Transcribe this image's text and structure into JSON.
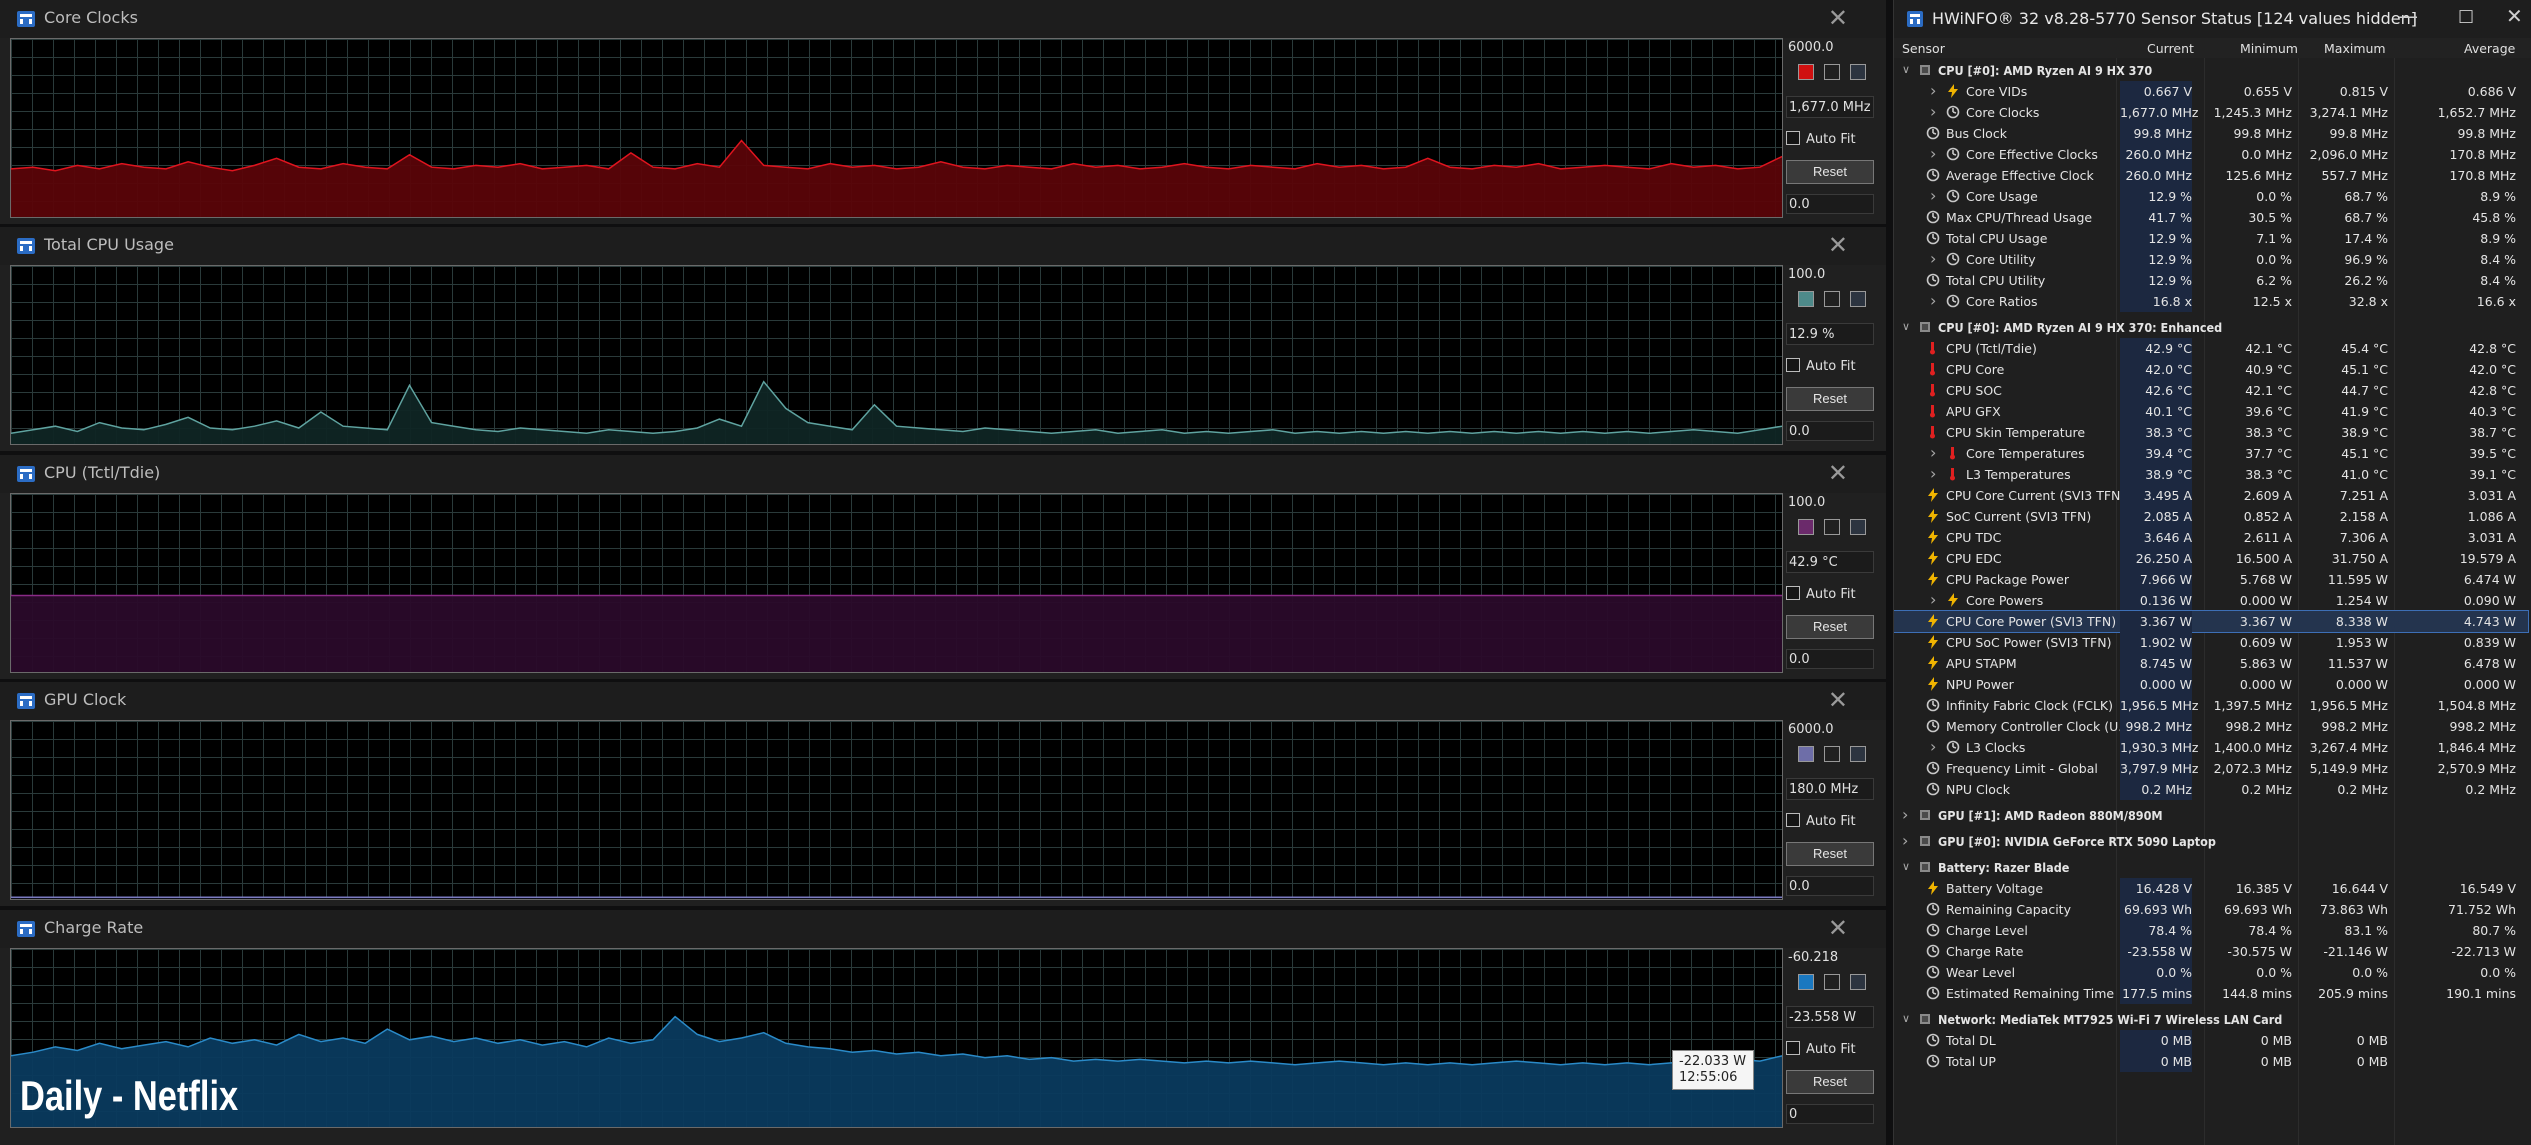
{
  "graphs": [
    {
      "title": "Core Clocks",
      "max": "6000.0",
      "current": "1,677.0 MHz",
      "min": "0.0",
      "auto_fit": "Auto Fit",
      "reset": "Reset",
      "color": "#e0141e",
      "fill": "#5a0408",
      "swatch": "#d01010",
      "level": 0.28,
      "spikes": [
        0.32,
        0.36,
        0.42
      ],
      "series": [
        0.27,
        0.28,
        0.26,
        0.29,
        0.27,
        0.3,
        0.28,
        0.27,
        0.31,
        0.28,
        0.26,
        0.29,
        0.33,
        0.28,
        0.27,
        0.3,
        0.28,
        0.27,
        0.35,
        0.28,
        0.27,
        0.29,
        0.28,
        0.3,
        0.27,
        0.28,
        0.29,
        0.27,
        0.36,
        0.28,
        0.27,
        0.3,
        0.28,
        0.43,
        0.29,
        0.28,
        0.27,
        0.3,
        0.28,
        0.29,
        0.27,
        0.28,
        0.31,
        0.28,
        0.27,
        0.29,
        0.28,
        0.27,
        0.3,
        0.28,
        0.29,
        0.27,
        0.28,
        0.3,
        0.28,
        0.27,
        0.29,
        0.28,
        0.27,
        0.3,
        0.28,
        0.29,
        0.27,
        0.28,
        0.33,
        0.28,
        0.27,
        0.29,
        0.28,
        0.3,
        0.27,
        0.28,
        0.29,
        0.28,
        0.27,
        0.3,
        0.28,
        0.29,
        0.27,
        0.28,
        0.34
      ]
    },
    {
      "title": "Total CPU Usage",
      "max": "100.0",
      "current": "12.9 %",
      "min": "0.0",
      "auto_fit": "Auto Fit",
      "reset": "Reset",
      "color": "#5fa3a0",
      "fill": "#0f2524",
      "swatch": "#4e8a8a",
      "series": [
        0.06,
        0.08,
        0.1,
        0.07,
        0.12,
        0.09,
        0.08,
        0.11,
        0.15,
        0.09,
        0.08,
        0.1,
        0.13,
        0.09,
        0.18,
        0.1,
        0.09,
        0.08,
        0.33,
        0.12,
        0.1,
        0.08,
        0.07,
        0.09,
        0.08,
        0.07,
        0.06,
        0.08,
        0.07,
        0.06,
        0.07,
        0.09,
        0.14,
        0.1,
        0.35,
        0.2,
        0.12,
        0.1,
        0.08,
        0.22,
        0.1,
        0.09,
        0.08,
        0.07,
        0.09,
        0.08,
        0.07,
        0.06,
        0.07,
        0.08,
        0.06,
        0.07,
        0.08,
        0.06,
        0.07,
        0.06,
        0.07,
        0.08,
        0.06,
        0.07,
        0.06,
        0.07,
        0.06,
        0.07,
        0.06,
        0.07,
        0.06,
        0.07,
        0.06,
        0.07,
        0.06,
        0.07,
        0.06,
        0.07,
        0.06,
        0.07,
        0.08,
        0.07,
        0.06,
        0.08,
        0.1
      ]
    },
    {
      "title": "CPU (Tctl/Tdie)",
      "max": "100.0",
      "current": "42.9 °C",
      "min": "0.0",
      "auto_fit": "Auto Fit",
      "reset": "Reset",
      "color": "#8a2a86",
      "fill": "#2a0a2a",
      "swatch": "#6b2a6b",
      "series": [
        0.43,
        0.43,
        0.43,
        0.43,
        0.43,
        0.43,
        0.43,
        0.43,
        0.43,
        0.43,
        0.43,
        0.43,
        0.43,
        0.43,
        0.43,
        0.43,
        0.43,
        0.43,
        0.43,
        0.43,
        0.43,
        0.43,
        0.43,
        0.43,
        0.43,
        0.43,
        0.43,
        0.43,
        0.43,
        0.43,
        0.43,
        0.43,
        0.43,
        0.43,
        0.43,
        0.43,
        0.43,
        0.43,
        0.43,
        0.43,
        0.43,
        0.43,
        0.43,
        0.43,
        0.43,
        0.43,
        0.43,
        0.43,
        0.43,
        0.43,
        0.43,
        0.43,
        0.43,
        0.43,
        0.43,
        0.43,
        0.43,
        0.43,
        0.43,
        0.43,
        0.43,
        0.43,
        0.43,
        0.43,
        0.43,
        0.43,
        0.43,
        0.43,
        0.43,
        0.43,
        0.43,
        0.43,
        0.43,
        0.43,
        0.43,
        0.43,
        0.43,
        0.43,
        0.43,
        0.43,
        0.43
      ]
    },
    {
      "title": "GPU Clock",
      "max": "6000.0",
      "current": "180.0 MHz",
      "min": "0.0",
      "auto_fit": "Auto Fit",
      "reset": "Reset",
      "color": "#7a7ac0",
      "fill": "#0c0c1a",
      "swatch": "#6e6ea8",
      "series": [
        0.01,
        0.01,
        0.01,
        0.01,
        0.01,
        0.01,
        0.01,
        0.01,
        0.01,
        0.01,
        0.01,
        0.01,
        0.01,
        0.01,
        0.01,
        0.01,
        0.01,
        0.01,
        0.01,
        0.01,
        0.01,
        0.01,
        0.01,
        0.01,
        0.01,
        0.01,
        0.01,
        0.01,
        0.01,
        0.01,
        0.01,
        0.01,
        0.01,
        0.01,
        0.01,
        0.01,
        0.01,
        0.01,
        0.01,
        0.01,
        0.01,
        0.01,
        0.01,
        0.01,
        0.01,
        0.01,
        0.01,
        0.01,
        0.01,
        0.01,
        0.01,
        0.01,
        0.01,
        0.01,
        0.01,
        0.01,
        0.01,
        0.01,
        0.01,
        0.01,
        0.01,
        0.01,
        0.01,
        0.01,
        0.01,
        0.01,
        0.01,
        0.01,
        0.01,
        0.01,
        0.01,
        0.01,
        0.01,
        0.01,
        0.01,
        0.01,
        0.01,
        0.01,
        0.01,
        0.01,
        0.01
      ]
    },
    {
      "title": "Charge Rate",
      "max": "-60.218",
      "current": "-23.558 W",
      "min": "0",
      "auto_fit": "Auto Fit",
      "reset": "Reset",
      "color": "#2a8ac8",
      "fill": "#0a3a5e",
      "swatch": "#1a78c0",
      "series": [
        0.4,
        0.42,
        0.45,
        0.43,
        0.47,
        0.44,
        0.46,
        0.48,
        0.45,
        0.5,
        0.47,
        0.49,
        0.46,
        0.52,
        0.48,
        0.5,
        0.47,
        0.55,
        0.49,
        0.51,
        0.48,
        0.5,
        0.47,
        0.49,
        0.46,
        0.48,
        0.45,
        0.5,
        0.47,
        0.49,
        0.62,
        0.52,
        0.48,
        0.5,
        0.53,
        0.47,
        0.45,
        0.44,
        0.42,
        0.43,
        0.41,
        0.42,
        0.4,
        0.41,
        0.39,
        0.4,
        0.38,
        0.39,
        0.37,
        0.38,
        0.37,
        0.38,
        0.37,
        0.36,
        0.37,
        0.36,
        0.37,
        0.36,
        0.35,
        0.36,
        0.37,
        0.36,
        0.35,
        0.36,
        0.35,
        0.36,
        0.35,
        0.36,
        0.37,
        0.36,
        0.35,
        0.36,
        0.35,
        0.36,
        0.35,
        0.36,
        0.37,
        0.36,
        0.38,
        0.37,
        0.4
      ]
    }
  ],
  "tooltip": {
    "value": "-22.033 W",
    "time": "12:55:06"
  },
  "watermark": "Daily - Netflix",
  "sensor": {
    "title": "HWiNFO® 32 v8.28-5770 Sensor Status [124 values hidden]",
    "columns": [
      "Sensor",
      "Current",
      "Minimum",
      "Maximum",
      "Average"
    ],
    "rows": [
      {
        "type": "group",
        "label": "CPU [#0]: AMD Ryzen AI 9 HX 370",
        "expanded": true
      },
      {
        "type": "item",
        "label": "Core VIDs",
        "icon": "bolt",
        "chev": true,
        "cur": "0.667 V",
        "min": "0.655 V",
        "max": "0.815 V",
        "avg": "0.686 V"
      },
      {
        "type": "item",
        "label": "Core Clocks",
        "icon": "clock",
        "chev": true,
        "cur": "1,677.0 MHz",
        "min": "1,245.3 MHz",
        "max": "3,274.1 MHz",
        "avg": "1,652.7 MHz"
      },
      {
        "type": "item",
        "label": "Bus Clock",
        "icon": "clock",
        "chev": false,
        "cur": "99.8 MHz",
        "min": "99.8 MHz",
        "max": "99.8 MHz",
        "avg": "99.8 MHz"
      },
      {
        "type": "item",
        "label": "Core Effective Clocks",
        "icon": "clock",
        "chev": true,
        "cur": "260.0 MHz",
        "min": "0.0 MHz",
        "max": "2,096.0 MHz",
        "avg": "170.8 MHz"
      },
      {
        "type": "item",
        "label": "Average Effective Clock",
        "icon": "clock",
        "chev": false,
        "cur": "260.0 MHz",
        "min": "125.6 MHz",
        "max": "557.7 MHz",
        "avg": "170.8 MHz"
      },
      {
        "type": "item",
        "label": "Core Usage",
        "icon": "clock",
        "chev": true,
        "cur": "12.9 %",
        "min": "0.0 %",
        "max": "68.7 %",
        "avg": "8.9 %"
      },
      {
        "type": "item",
        "label": "Max CPU/Thread Usage",
        "icon": "clock",
        "chev": false,
        "cur": "41.7 %",
        "min": "30.5 %",
        "max": "68.7 %",
        "avg": "45.8 %"
      },
      {
        "type": "item",
        "label": "Total CPU Usage",
        "icon": "clock",
        "chev": false,
        "cur": "12.9 %",
        "min": "7.1 %",
        "max": "17.4 %",
        "avg": "8.9 %"
      },
      {
        "type": "item",
        "label": "Core Utility",
        "icon": "clock",
        "chev": true,
        "cur": "12.9 %",
        "min": "0.0 %",
        "max": "96.9 %",
        "avg": "8.4 %"
      },
      {
        "type": "item",
        "label": "Total CPU Utility",
        "icon": "clock",
        "chev": false,
        "cur": "12.9 %",
        "min": "6.2 %",
        "max": "26.2 %",
        "avg": "8.4 %"
      },
      {
        "type": "item",
        "label": "Core Ratios",
        "icon": "clock",
        "chev": true,
        "cur": "16.8 x",
        "min": "12.5 x",
        "max": "32.8 x",
        "avg": "16.6 x"
      },
      {
        "type": "gap"
      },
      {
        "type": "group",
        "label": "CPU [#0]: AMD Ryzen AI 9 HX 370: Enhanced",
        "expanded": true
      },
      {
        "type": "item",
        "label": "CPU (Tctl/Tdie)",
        "icon": "therm",
        "chev": false,
        "cur": "42.9 °C",
        "min": "42.1 °C",
        "max": "45.4 °C",
        "avg": "42.8 °C"
      },
      {
        "type": "item",
        "label": "CPU Core",
        "icon": "therm",
        "chev": false,
        "cur": "42.0 °C",
        "min": "40.9 °C",
        "max": "45.1 °C",
        "avg": "42.0 °C"
      },
      {
        "type": "item",
        "label": "CPU SOC",
        "icon": "therm",
        "chev": false,
        "cur": "42.6 °C",
        "min": "42.1 °C",
        "max": "44.7 °C",
        "avg": "42.8 °C"
      },
      {
        "type": "item",
        "label": "APU GFX",
        "icon": "therm",
        "chev": false,
        "cur": "40.1 °C",
        "min": "39.6 °C",
        "max": "41.9 °C",
        "avg": "40.3 °C"
      },
      {
        "type": "item",
        "label": "CPU Skin Temperature",
        "icon": "therm",
        "chev": false,
        "cur": "38.3 °C",
        "min": "38.3 °C",
        "max": "38.9 °C",
        "avg": "38.7 °C"
      },
      {
        "type": "item",
        "label": "Core Temperatures",
        "icon": "therm",
        "chev": true,
        "cur": "39.4 °C",
        "min": "37.7 °C",
        "max": "45.1 °C",
        "avg": "39.5 °C"
      },
      {
        "type": "item",
        "label": "L3 Temperatures",
        "icon": "therm",
        "chev": true,
        "cur": "38.9 °C",
        "min": "38.3 °C",
        "max": "41.0 °C",
        "avg": "39.1 °C"
      },
      {
        "type": "item",
        "label": "CPU Core Current (SVI3 TFN)",
        "icon": "bolt",
        "chev": false,
        "cur": "3.495 A",
        "min": "2.609 A",
        "max": "7.251 A",
        "avg": "3.031 A"
      },
      {
        "type": "item",
        "label": "SoC Current (SVI3 TFN)",
        "icon": "bolt",
        "chev": false,
        "cur": "2.085 A",
        "min": "0.852 A",
        "max": "2.158 A",
        "avg": "1.086 A"
      },
      {
        "type": "item",
        "label": "CPU TDC",
        "icon": "bolt",
        "chev": false,
        "cur": "3.646 A",
        "min": "2.611 A",
        "max": "7.306 A",
        "avg": "3.031 A"
      },
      {
        "type": "item",
        "label": "CPU EDC",
        "icon": "bolt",
        "chev": false,
        "cur": "26.250 A",
        "min": "16.500 A",
        "max": "31.750 A",
        "avg": "19.579 A"
      },
      {
        "type": "item",
        "label": "CPU Package Power",
        "icon": "bolt",
        "chev": false,
        "cur": "7.966 W",
        "min": "5.768 W",
        "max": "11.595 W",
        "avg": "6.474 W"
      },
      {
        "type": "item",
        "label": "Core Powers",
        "icon": "bolt",
        "chev": true,
        "cur": "0.136 W",
        "min": "0.000 W",
        "max": "1.254 W",
        "avg": "0.090 W"
      },
      {
        "type": "item",
        "label": "CPU Core Power (SVI3 TFN)",
        "icon": "bolt",
        "chev": false,
        "sel": true,
        "cur": "3.367 W",
        "min": "3.367 W",
        "max": "8.338 W",
        "avg": "4.743 W"
      },
      {
        "type": "item",
        "label": "CPU SoC Power (SVI3 TFN)",
        "icon": "bolt",
        "chev": false,
        "cur": "1.902 W",
        "min": "0.609 W",
        "max": "1.953 W",
        "avg": "0.839 W"
      },
      {
        "type": "item",
        "label": "APU STAPM",
        "icon": "bolt",
        "chev": false,
        "cur": "8.745 W",
        "min": "5.863 W",
        "max": "11.537 W",
        "avg": "6.478 W"
      },
      {
        "type": "item",
        "label": "NPU Power",
        "icon": "bolt",
        "chev": false,
        "cur": "0.000 W",
        "min": "0.000 W",
        "max": "0.000 W",
        "avg": "0.000 W"
      },
      {
        "type": "item",
        "label": "Infinity Fabric Clock (FCLK)",
        "icon": "clock",
        "chev": false,
        "cur": "1,956.5 MHz",
        "min": "1,397.5 MHz",
        "max": "1,956.5 MHz",
        "avg": "1,504.8 MHz"
      },
      {
        "type": "item",
        "label": "Memory Controller Clock (U...",
        "icon": "clock",
        "chev": false,
        "cur": "998.2 MHz",
        "min": "998.2 MHz",
        "max": "998.2 MHz",
        "avg": "998.2 MHz"
      },
      {
        "type": "item",
        "label": "L3 Clocks",
        "icon": "clock",
        "chev": true,
        "cur": "1,930.3 MHz",
        "min": "1,400.0 MHz",
        "max": "3,267.4 MHz",
        "avg": "1,846.4 MHz"
      },
      {
        "type": "item",
        "label": "Frequency Limit - Global",
        "icon": "clock",
        "chev": false,
        "cur": "3,797.9 MHz",
        "min": "2,072.3 MHz",
        "max": "5,149.9 MHz",
        "avg": "2,570.9 MHz"
      },
      {
        "type": "item",
        "label": "NPU Clock",
        "icon": "clock",
        "chev": false,
        "cur": "0.2 MHz",
        "min": "0.2 MHz",
        "max": "0.2 MHz",
        "avg": "0.2 MHz"
      },
      {
        "type": "gap"
      },
      {
        "type": "group",
        "label": "GPU [#1]: AMD Radeon 880M/890M",
        "expanded": false
      },
      {
        "type": "gap"
      },
      {
        "type": "group",
        "label": "GPU [#0]: NVIDIA GeForce RTX 5090 Laptop",
        "expanded": false
      },
      {
        "type": "gap"
      },
      {
        "type": "group",
        "label": "Battery: Razer Blade",
        "expanded": true
      },
      {
        "type": "item",
        "label": "Battery Voltage",
        "icon": "bolt",
        "chev": false,
        "cur": "16.428 V",
        "min": "16.385 V",
        "max": "16.644 V",
        "avg": "16.549 V"
      },
      {
        "type": "item",
        "label": "Remaining Capacity",
        "icon": "clock",
        "chev": false,
        "cur": "69.693 Wh",
        "min": "69.693 Wh",
        "max": "73.863 Wh",
        "avg": "71.752 Wh"
      },
      {
        "type": "item",
        "label": "Charge Level",
        "icon": "clock",
        "chev": false,
        "cur": "78.4 %",
        "min": "78.4 %",
        "max": "83.1 %",
        "avg": "80.7 %"
      },
      {
        "type": "item",
        "label": "Charge Rate",
        "icon": "clock",
        "chev": false,
        "cur": "-23.558 W",
        "min": "-30.575 W",
        "max": "-21.146 W",
        "avg": "-22.713 W"
      },
      {
        "type": "item",
        "label": "Wear Level",
        "icon": "clock",
        "chev": false,
        "cur": "0.0 %",
        "min": "0.0 %",
        "max": "0.0 %",
        "avg": "0.0 %"
      },
      {
        "type": "item",
        "label": "Estimated Remaining Time",
        "icon": "clock",
        "chev": false,
        "cur": "177.5 mins",
        "min": "144.8 mins",
        "max": "205.9 mins",
        "avg": "190.1 mins"
      },
      {
        "type": "gap"
      },
      {
        "type": "group",
        "label": "Network: MediaTek MT7925 Wi-Fi 7 Wireless LAN Card",
        "expanded": true
      },
      {
        "type": "item",
        "label": "Total DL",
        "icon": "clock",
        "chev": false,
        "cur": "0 MB",
        "min": "0 MB",
        "max": "0 MB",
        "avg": ""
      },
      {
        "type": "item",
        "label": "Total UP",
        "icon": "clock",
        "chev": false,
        "cur": "0 MB",
        "min": "0 MB",
        "max": "0 MB",
        "avg": ""
      }
    ]
  }
}
